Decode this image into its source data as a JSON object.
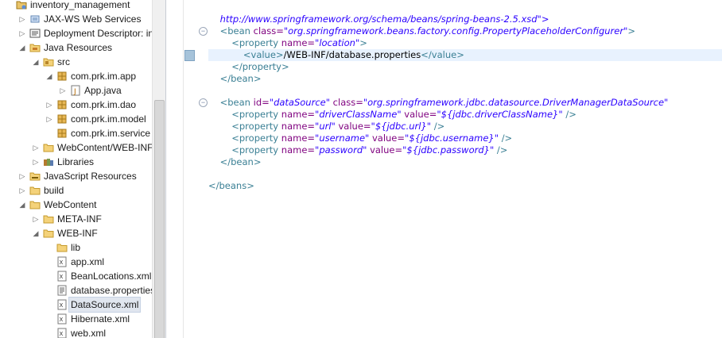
{
  "colors": {
    "tag": "#3a7f94",
    "attr_name": "#7f007f",
    "attr_value": "#2a00ff",
    "selection": "#e0e6ef"
  },
  "explorer": {
    "items": [
      {
        "label": "inventory_management",
        "icon": "project-icon",
        "twisty": ""
      },
      {
        "label": "JAX-WS Web Services",
        "icon": "webservices-icon",
        "twisty": "▷"
      },
      {
        "label": "Deployment Descriptor: inv",
        "icon": "descriptor-icon",
        "twisty": "▷"
      },
      {
        "label": "Java Resources",
        "icon": "java-resources-icon",
        "twisty": "◢"
      },
      {
        "label": "src",
        "icon": "source-folder-icon",
        "twisty": "◢"
      },
      {
        "label": "com.prk.im.app",
        "icon": "package-icon",
        "twisty": "◢"
      },
      {
        "label": "App.java",
        "icon": "java-file-icon",
        "twisty": "▷"
      },
      {
        "label": "com.prk.im.dao",
        "icon": "package-icon",
        "twisty": "▷"
      },
      {
        "label": "com.prk.im.model",
        "icon": "package-icon",
        "twisty": "▷"
      },
      {
        "label": "com.prk.im.service",
        "icon": "package-icon",
        "twisty": ""
      },
      {
        "label": "WebContent/WEB-INF",
        "icon": "folder-icon",
        "twisty": "▷"
      },
      {
        "label": "Libraries",
        "icon": "libraries-icon",
        "twisty": "▷"
      },
      {
        "label": "JavaScript Resources",
        "icon": "javascript-resources-icon",
        "twisty": "▷"
      },
      {
        "label": "build",
        "icon": "folder-icon",
        "twisty": "▷"
      },
      {
        "label": "WebContent",
        "icon": "folder-icon",
        "twisty": "◢"
      },
      {
        "label": "META-INF",
        "icon": "folder-icon",
        "twisty": "▷"
      },
      {
        "label": "WEB-INF",
        "icon": "folder-icon",
        "twisty": "◢"
      },
      {
        "label": "lib",
        "icon": "folder-icon",
        "twisty": ""
      },
      {
        "label": "app.xml",
        "icon": "xml-file-icon",
        "twisty": ""
      },
      {
        "label": "BeanLocations.xml",
        "icon": "xml-file-icon",
        "twisty": ""
      },
      {
        "label": "database.properties",
        "icon": "properties-file-icon",
        "twisty": ""
      },
      {
        "label": "DataSource.xml",
        "icon": "xml-file-icon",
        "twisty": "",
        "selected": true
      },
      {
        "label": "Hibernate.xml",
        "icon": "xml-file-icon",
        "twisty": ""
      },
      {
        "label": "web.xml",
        "icon": "xml-file-icon",
        "twisty": ""
      }
    ]
  },
  "editor": {
    "schema_line": "http://www.springframework.org/schema/beans/spring-beans-2.5.xsd\">",
    "placeholder_bean": {
      "open_tag": "<bean",
      "class_attr": "class=",
      "class_value": "\"org.springframework.beans.factory.config.PropertyPlaceholderConfigurer\"",
      "open_end": ">",
      "property_open": "<property",
      "name_attr": "name=",
      "name_value": "\"location\"",
      "property_end": ">",
      "value_open": "<value>",
      "value_text": "/WEB-INF/database.properties",
      "value_close": "</value>",
      "property_close": "</property>",
      "bean_close": "</bean>"
    },
    "datasource_bean": {
      "open_tag": "<bean",
      "id_attr": "id=",
      "id_value": "\"dataSource\"",
      "class_attr": "class=",
      "class_value": "\"org.springframework.jdbc.datasource.DriverManagerDataSource\"",
      "properties": [
        {
          "name": "\"driverClassName\"",
          "value": "\"${jdbc.driverClassName}\""
        },
        {
          "name": "\"url\"",
          "value": "\"${jdbc.url}\""
        },
        {
          "name": "\"username\"",
          "value": "\"${jdbc.username}\""
        },
        {
          "name": "\"password\"",
          "value": "\"${jdbc.password}\""
        }
      ],
      "property_tag": "<property",
      "name_attr": "name=",
      "value_attr": "value=",
      "self_close": "/>",
      "bean_close": "</bean>"
    },
    "beans_close": "</beans>"
  }
}
